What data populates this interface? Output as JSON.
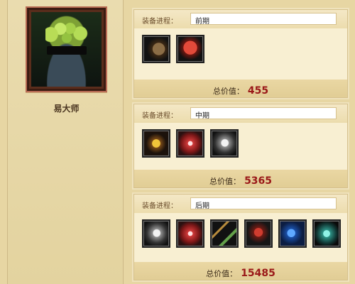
{
  "hero": {
    "name": "易大师",
    "icon": "hero-portrait-icon"
  },
  "builds": [
    {
      "label": "装备进程：",
      "stage": "前期",
      "total_label": "总价值：",
      "total_value": "455",
      "items": [
        "boots-icon",
        "red-robe-icon"
      ]
    },
    {
      "label": "装备进程：",
      "stage": "中期",
      "total_label": "总价值：",
      "total_value": "5365",
      "items": [
        "gauntlet-icon",
        "crossed-swords-icon",
        "helmet-icon"
      ]
    },
    {
      "label": "装备进程：",
      "stage": "后期",
      "total_label": "总价值：",
      "total_value": "15485",
      "items": [
        "helmet-icon",
        "crossed-swords-icon",
        "spear-icon",
        "red-armor-icon",
        "blue-cloak-icon",
        "winged-armor-icon"
      ]
    }
  ],
  "colors": {
    "background": "#e7d6a3",
    "panel": "#f8efd2",
    "total": "#9a1818"
  }
}
